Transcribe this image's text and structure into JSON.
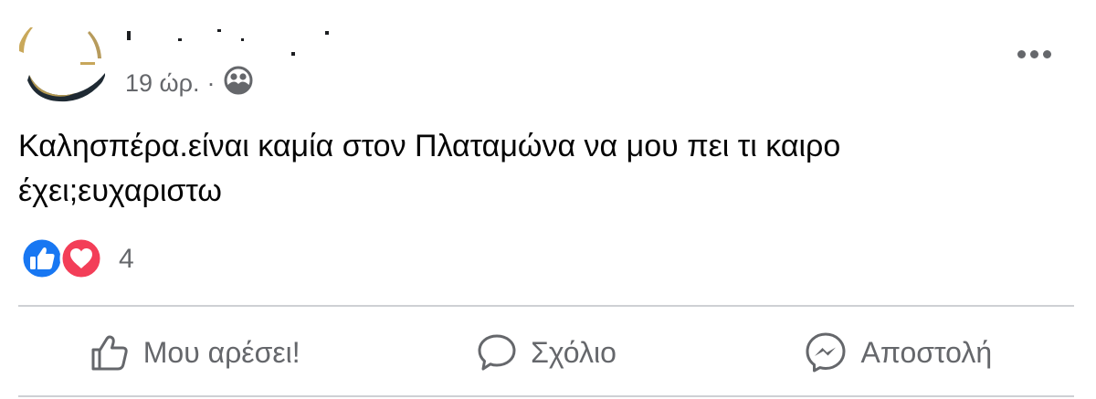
{
  "post": {
    "author_name": "",
    "timestamp": "19 ώρ.",
    "separator": "·",
    "audience_icon": "friends-icon",
    "options_icon": "more-options-icon",
    "text_lines": [
      "Καλησπέρα.είναι καμία στον Πλαταμώνα να μου πει τι καιρο",
      "έχει;ευχαριστω"
    ],
    "reactions": {
      "types": [
        "like-icon",
        "love-icon"
      ],
      "count": "4"
    }
  },
  "actions": {
    "like_label": "Μου αρέσει!",
    "comment_label": "Σχόλιο",
    "share_label": "Αποστολή"
  },
  "colors": {
    "text": "#050505",
    "secondary": "#65676b",
    "like_blue": "#1877f2",
    "love_red": "#f33e58",
    "divider": "#ced0d4"
  }
}
